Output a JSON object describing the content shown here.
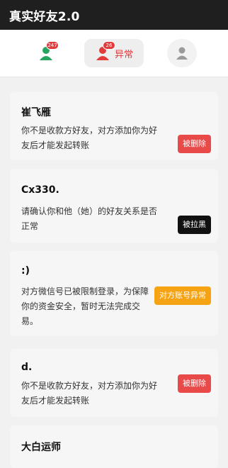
{
  "app": {
    "title": "真实好友2.0"
  },
  "tabs": [
    {
      "name": "tab-friends",
      "badge": "247"
    },
    {
      "name": "tab-abnormal",
      "badge": "26",
      "label": "异常"
    },
    {
      "name": "tab-profile"
    }
  ],
  "colors": {
    "accent": "#e23b3b",
    "delete": "#e84a4a",
    "block": "#111111",
    "warning": "#f5a213"
  },
  "contacts": [
    {
      "name": "崔飞雁",
      "message": "你不是收款方好友，对方添加你为好友后才能发起转账",
      "action": "被删除",
      "status": "deleted"
    },
    {
      "name": "Cx330.",
      "message": "请确认你和他（她）的好友关系是否正常",
      "action": "被拉黑",
      "status": "blocked"
    },
    {
      "name": ":)",
      "message": "对方微信号已被限制登录，为保障你的资金安全，暂时无法完成交易。",
      "action": "对方账号异常",
      "status": "restricted"
    },
    {
      "name": "d.",
      "message": "你不是收款方好友，对方添加你为好友后才能发起转账",
      "action": "被删除",
      "status": "deleted"
    },
    {
      "name": "大白运师"
    }
  ]
}
